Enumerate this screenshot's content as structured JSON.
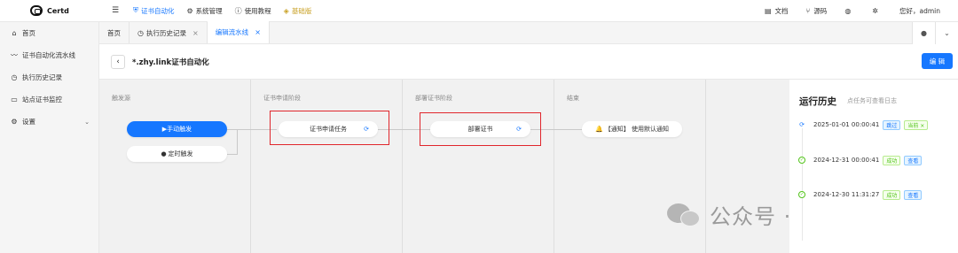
{
  "app": {
    "logo_text": "Certd"
  },
  "topnav": {
    "items": [
      {
        "label": "证书自动化",
        "icon": "shield-icon"
      },
      {
        "label": "系统管理",
        "icon": "gear-icon"
      },
      {
        "label": "使用教程",
        "icon": "help-icon"
      },
      {
        "label": "基础版",
        "icon": "diamond-icon"
      }
    ],
    "right": {
      "docs": "文档",
      "source": "源码",
      "greeting": "您好，admin"
    }
  },
  "sidebar": {
    "items": [
      {
        "label": "首页",
        "icon": "home-icon"
      },
      {
        "label": "证书自动化流水线",
        "icon": "trend-icon"
      },
      {
        "label": "执行历史记录",
        "icon": "history-icon"
      },
      {
        "label": "站点证书监控",
        "icon": "monitor-icon"
      },
      {
        "label": "设置",
        "icon": "gear-icon"
      }
    ]
  },
  "tabs": [
    {
      "label": "首页"
    },
    {
      "label": "执行历史记录"
    },
    {
      "label": "编辑流水线"
    }
  ],
  "page": {
    "title": "*.zhy.link证书自动化",
    "edit_label": "编 辑"
  },
  "stages": [
    {
      "title": "触发源"
    },
    {
      "title": "证书申请阶段"
    },
    {
      "title": "部署证书阶段"
    },
    {
      "title": "结束"
    }
  ],
  "nodes": {
    "manual_trigger": "▶手动触发",
    "timer_trigger": "定时触发",
    "apply_task": "证书申请任务",
    "deploy_task": "部署证书",
    "notify": "【通知】 使用默认通知"
  },
  "history": {
    "title": "运行历史",
    "subtitle": "点任务可查看日志",
    "items": [
      {
        "time": "2025-01-01 00:00:41",
        "status": "pending",
        "tags": [
          {
            "text": "跳过",
            "color": "blue"
          },
          {
            "text": "当前 ×",
            "color": "green"
          }
        ]
      },
      {
        "time": "2024-12-31 00:00:41",
        "status": "success",
        "tags": [
          {
            "text": "成功",
            "color": "green"
          },
          {
            "text": "查看",
            "color": "blue"
          }
        ]
      },
      {
        "time": "2024-12-30 11:31:27",
        "status": "success",
        "tags": [
          {
            "text": "成功",
            "color": "green"
          },
          {
            "text": "查看",
            "color": "blue"
          }
        ]
      }
    ]
  },
  "watermark": "公众号 · 源话编程",
  "colors": {
    "accent": "#1677ff",
    "highlight": "#e0262c",
    "success": "#52c41a"
  }
}
